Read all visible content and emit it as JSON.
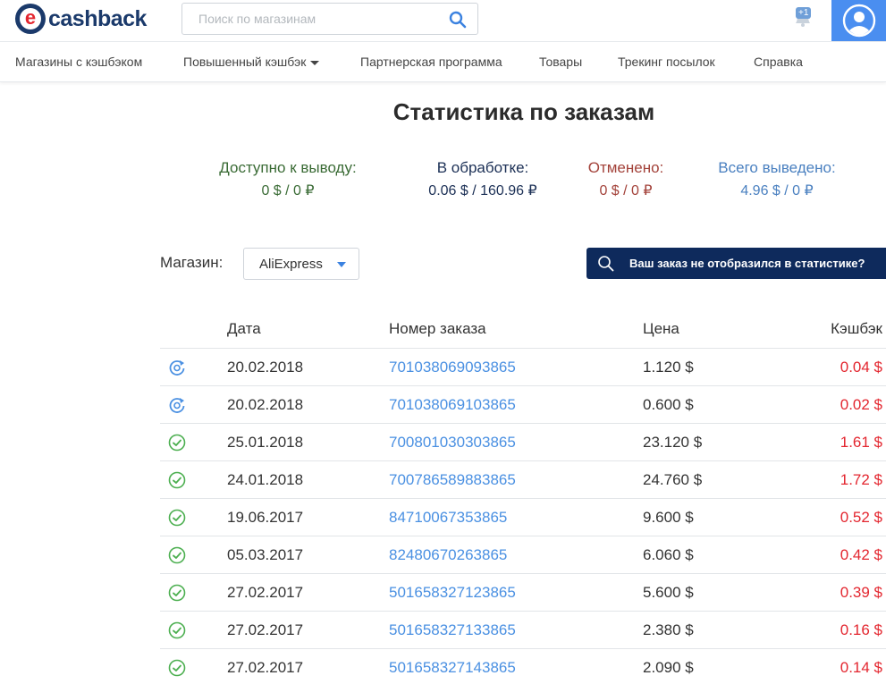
{
  "header": {
    "logo_text": "cashback",
    "logo_letter": "e",
    "search_placeholder": "Поиск по магазинам",
    "notification_badge": "+1"
  },
  "nav": {
    "items": [
      {
        "label": "Магазины с кэшбэком"
      },
      {
        "label": "Повышенный кэшбэк"
      },
      {
        "label": "Партнерская программа"
      },
      {
        "label": "Товары"
      },
      {
        "label": "Трекинг посылок"
      },
      {
        "label": "Справка"
      }
    ]
  },
  "page": {
    "title": "Статистика по заказам"
  },
  "stats": {
    "available": {
      "label": "Доступно к выводу:",
      "value": "0 $ / 0 ₽",
      "color": "#3a6b35"
    },
    "processing": {
      "label": "В обработке:",
      "value": "0.06 $ / 160.96 ₽",
      "color": "#1b2f55"
    },
    "cancelled": {
      "label": "Отменено:",
      "value": "0 $ / 0 ₽",
      "color": "#a3423a"
    },
    "withdrawn": {
      "label": "Всего выведено:",
      "value": "4.96 $ / 0 ₽",
      "color": "#4a80c0"
    }
  },
  "filter": {
    "shop_label": "Магазин:",
    "shop_value": "AliExpress",
    "missing_order_button": "Ваш заказ не отобразился в статистике?"
  },
  "table": {
    "headers": {
      "date": "Дата",
      "order": "Номер заказа",
      "price": "Цена",
      "cashback": "Кэшбэк"
    },
    "rows": [
      {
        "status": "pending",
        "status_icon": "refresh-icon",
        "date": "20.02.2018",
        "order": "701038069093865",
        "price": "1.120 $",
        "cashback": "0.04 $"
      },
      {
        "status": "pending",
        "status_icon": "refresh-icon",
        "date": "20.02.2018",
        "order": "701038069103865",
        "price": "0.600 $",
        "cashback": "0.02 $"
      },
      {
        "status": "confirmed",
        "status_icon": "check-circle-icon",
        "date": "25.01.2018",
        "order": "700801030303865",
        "price": "23.120 $",
        "cashback": "1.61 $"
      },
      {
        "status": "confirmed",
        "status_icon": "check-circle-icon",
        "date": "24.01.2018",
        "order": "700786589883865",
        "price": "24.760 $",
        "cashback": "1.72 $"
      },
      {
        "status": "confirmed",
        "status_icon": "check-circle-icon",
        "date": "19.06.2017",
        "order": "84710067353865",
        "price": "9.600 $",
        "cashback": "0.52 $"
      },
      {
        "status": "confirmed",
        "status_icon": "check-circle-icon",
        "date": "05.03.2017",
        "order": "82480670263865",
        "price": "6.060 $",
        "cashback": "0.42 $"
      },
      {
        "status": "confirmed",
        "status_icon": "check-circle-icon",
        "date": "27.02.2017",
        "order": "501658327123865",
        "price": "5.600 $",
        "cashback": "0.39 $"
      },
      {
        "status": "confirmed",
        "status_icon": "check-circle-icon",
        "date": "27.02.2017",
        "order": "501658327133865",
        "price": "2.380 $",
        "cashback": "0.16 $"
      },
      {
        "status": "confirmed",
        "status_icon": "check-circle-icon",
        "date": "27.02.2017",
        "order": "501658327143865",
        "price": "2.090 $",
        "cashback": "0.14 $"
      }
    ]
  },
  "colors": {
    "brand": "#1b3a6b",
    "accent": "#4a8ef0",
    "link": "#4a90e2",
    "cashback": "#e3262f",
    "check": "#4caf50",
    "pending": "#4a90e2",
    "button_dark": "#0e2a5c"
  }
}
